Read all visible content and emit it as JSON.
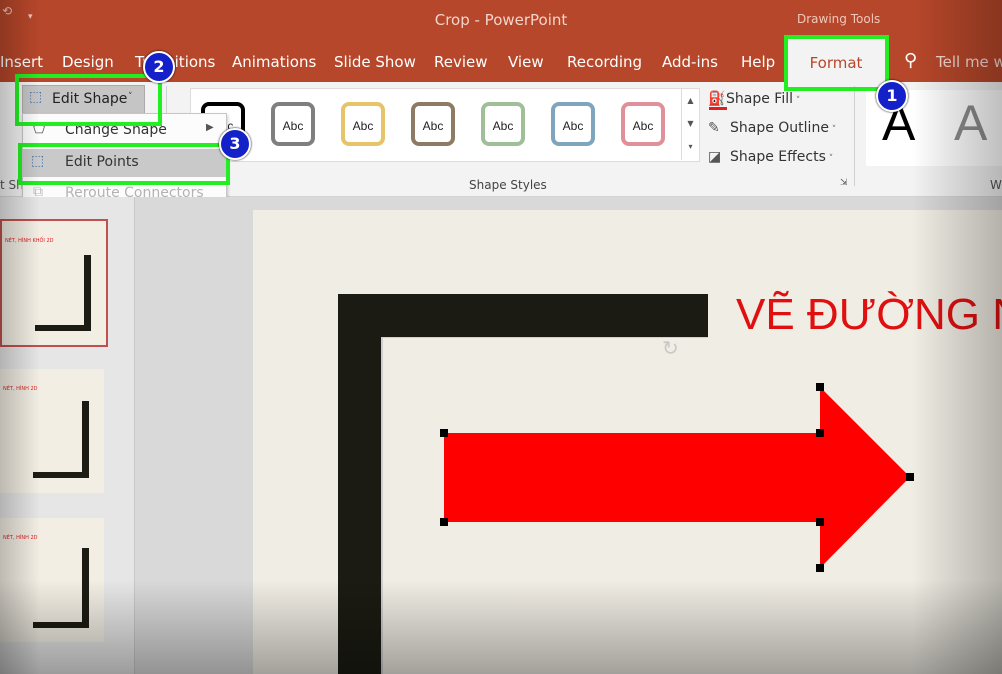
{
  "window": {
    "title": "Crop  -  PowerPoint",
    "context_tab_group": "Drawing Tools",
    "quick_access_icon": "undo-icon",
    "tell_me_placeholder": "Tell me wh"
  },
  "tabs": [
    {
      "label": "Insert"
    },
    {
      "label": "Design"
    },
    {
      "label": "Transitions"
    },
    {
      "label": "Animations"
    },
    {
      "label": "Slide Show"
    },
    {
      "label": "Review"
    },
    {
      "label": "View"
    },
    {
      "label": "Recording"
    },
    {
      "label": "Add-ins"
    },
    {
      "label": "Help"
    },
    {
      "label": "Format",
      "active": true
    }
  ],
  "ribbon": {
    "edit_shape_label": "Edit Shape",
    "shape_styles_group": "Shape Styles",
    "shape_style_sample": "Abc",
    "shape_style_colors": [
      "#000000",
      "#7f7f7f",
      "#e6c46a",
      "#8d7b64",
      "#9fbf99",
      "#7fa4bd",
      "#e0909a"
    ],
    "shape_fill": "Shape Fill",
    "shape_outline": "Shape Outline",
    "shape_effects": "Shape Effects",
    "wordart_sample": "A",
    "left_group_fragment": "t Sha",
    "right_group_fragment": "W"
  },
  "edit_shape_menu": {
    "items": [
      {
        "label": "Change Shape",
        "enabled": true,
        "has_submenu": true
      },
      {
        "label": "Edit Points",
        "enabled": true,
        "highlighted": true
      },
      {
        "label": "Reroute Connectors",
        "enabled": false
      }
    ]
  },
  "annotations": {
    "badges": [
      "1",
      "2",
      "3"
    ],
    "highlight_color": "#22ee22",
    "badge_color": "#1420c8"
  },
  "thumbnails": [
    {
      "caption": "NÉT, HÌNH KHỐI 2D",
      "selected": true
    },
    {
      "caption": "NÉT, HÌNH 2D",
      "selected": false
    },
    {
      "caption": "NÉT, HÌNH 2D",
      "selected": false
    }
  ],
  "slide": {
    "title_text": "VẼ ĐƯỜNG N",
    "title_color": "#e01010",
    "arrow_color": "#ff0000",
    "frame_color": "#1b1b13"
  },
  "colors": {
    "accent": "#b7472a",
    "ribbon_bg": "#f3f3f3"
  }
}
